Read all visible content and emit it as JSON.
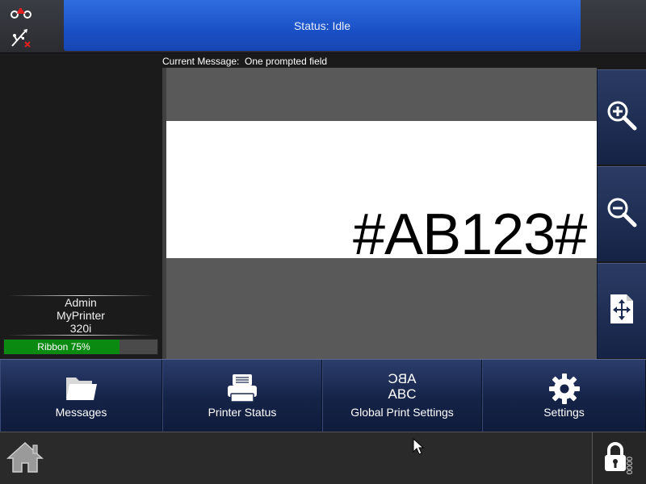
{
  "header": {
    "status_text": "Status: Idle",
    "icons": [
      "tractor-icon",
      "usb-disconnected-icon"
    ]
  },
  "current_message": {
    "label": "Current Message:",
    "name": "One prompted field",
    "full": "Current Message:  One prompted field"
  },
  "left_panel": {
    "user": "Admin",
    "printer_name": "MyPrinter",
    "model": "320i",
    "ribbon": {
      "label": "Ribbon 75%",
      "level": 0.75,
      "fill_color": "#0b8a12"
    }
  },
  "preview": {
    "field_text": "#AB123#"
  },
  "tools": [
    {
      "name": "zoom-in-icon"
    },
    {
      "name": "zoom-out-icon"
    },
    {
      "name": "move-fit-icon"
    }
  ],
  "nav": {
    "messages": "Messages",
    "printer_status": "Printer Status",
    "global_print_settings": "Global Print Settings",
    "global_icon_text_top": "ABC",
    "global_icon_text_bottom": "ABC",
    "settings": "Settings"
  },
  "footer": {
    "lock_code": "0000"
  },
  "colors": {
    "status_blue": "#1a50c6",
    "nav_blue": "#142347",
    "ribbon_green": "#0b8a12"
  }
}
